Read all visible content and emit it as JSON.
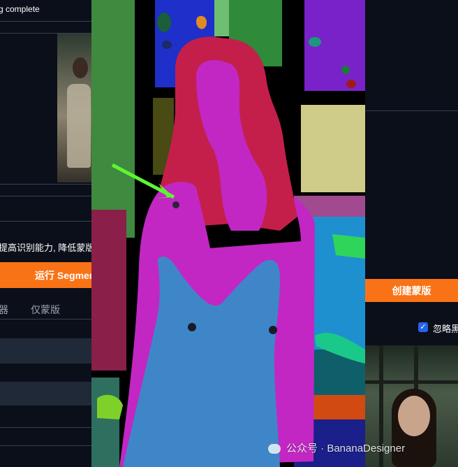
{
  "left_panel": {
    "status": "g complete",
    "hint": "提高识别能力, 降低蒙版",
    "run_button": "运行 Segmen",
    "tabs": [
      "器",
      "仅蒙版"
    ]
  },
  "right_panel": {
    "create_mask_button": "创建蒙版",
    "ignore_checkbox_label": "忽略黑",
    "ignore_checked": true
  },
  "watermark": "公众号 · BananaDesigner",
  "colors": {
    "accent": "#f97316",
    "checkbox": "#2563eb",
    "background": "#0b0f19"
  }
}
